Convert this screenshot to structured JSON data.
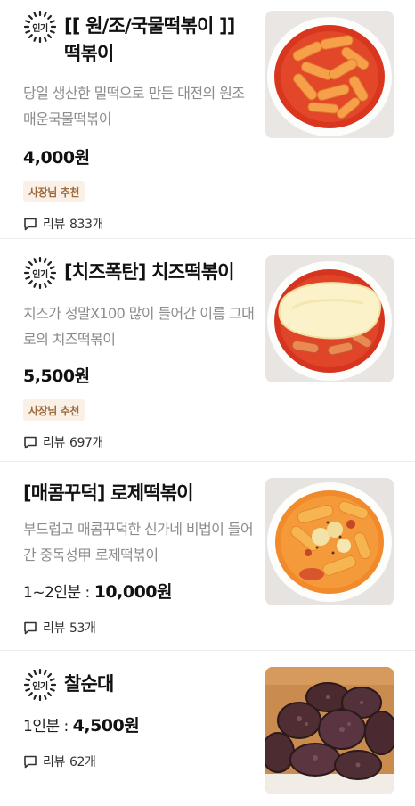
{
  "items": [
    {
      "badge": "인기",
      "title": "[[ 원/조/국물떡볶이 ]] 떡볶이",
      "description": "당일 생산한 밀떡으로 만든 대전의 원조 매운국물떡볶이",
      "portion": "",
      "price": "4,000원",
      "owner_badge": "사장님 추천",
      "review_label": "리뷰",
      "review_count": "833개",
      "image_icon": "tteokbokki-bowl-image"
    },
    {
      "badge": "인기",
      "title": "[치즈폭탄] 치즈떡볶이",
      "description": "치즈가 정말X100 많이 들어간 이름 그대로의 치즈떡볶이",
      "portion": "",
      "price": "5,500원",
      "owner_badge": "사장님 추천",
      "review_label": "리뷰",
      "review_count": "697개",
      "image_icon": "cheese-tteokbokki-image"
    },
    {
      "badge": "",
      "title": "[매콤꾸덕] 로제떡볶이",
      "description": "부드럽고 매콤꾸덕한 신가네 비법이 들어간 중독성甲 로제떡볶이",
      "portion": "1~2인분 : ",
      "price": "10,000원",
      "owner_badge": "",
      "review_label": "리뷰",
      "review_count": "53개",
      "image_icon": "rose-tteokbokki-image"
    },
    {
      "badge": "인기",
      "title": "찰순대",
      "description": "",
      "portion": "1인분 : ",
      "price": "4,500원",
      "owner_badge": "",
      "review_label": "리뷰",
      "review_count": "62개",
      "image_icon": "sundae-image"
    }
  ]
}
